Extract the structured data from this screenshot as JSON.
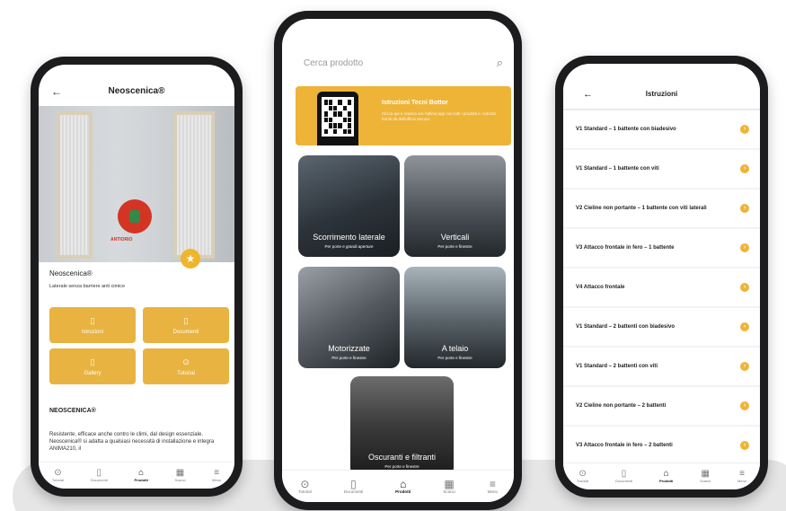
{
  "colors": {
    "accent": "#e8b341",
    "alert": "#d43424"
  },
  "left": {
    "back_icon": "arrow-left-icon",
    "title": "Neoscenica®",
    "red_button_label": "ANTIORIO",
    "product_name": "Neoscenica®",
    "product_desc": "Laterale senza barriere anti cimice",
    "tiles": [
      {
        "label": "Istruzioni",
        "icon": "▯"
      },
      {
        "label": "Documenti",
        "icon": "▯"
      },
      {
        "label": "Gallery",
        "icon": "▯"
      },
      {
        "label": "Tutorial",
        "icon": "⊙"
      }
    ],
    "section_title": "NEOSCENICA®",
    "section_body": "Resistente, efficace anche contro le climi, dal design essenziale. Neoscenica® si adatta a qualsiasi necessità di installazione e integra ANIMA210, il",
    "tabs": [
      {
        "label": "Tutorial",
        "icon": "⊙"
      },
      {
        "label": "Documenti",
        "icon": "▯"
      },
      {
        "label": "Prodotti",
        "icon": "⌂"
      },
      {
        "label": "Scanci",
        "icon": "▦"
      },
      {
        "label": "Menu",
        "icon": "≡"
      }
    ]
  },
  "mid": {
    "search_placeholder": "Cerca prodotto",
    "promo_title": "Istruzioni Tecni Bottor",
    "promo_body": "Clicca qui e scarica ora l'ultima app con tutti i prodotti e i tutorial forniti da dall'ufficio tecnico",
    "categories": [
      {
        "title": "Scorrimento laterale",
        "subtitle": "Per porte e grandi aperture"
      },
      {
        "title": "Verticali",
        "subtitle": "Per porte e finestre"
      },
      {
        "title": "Motorizzate",
        "subtitle": "Per porte e finestre"
      },
      {
        "title": "A telaio",
        "subtitle": "Per porte e finestre"
      },
      {
        "title": "Oscuranti e filtranti",
        "subtitle": "Per porte e finestre"
      }
    ],
    "tabs": [
      {
        "label": "Tutorial",
        "icon": "⊙"
      },
      {
        "label": "Documenti",
        "icon": "▯"
      },
      {
        "label": "Prodotti",
        "icon": "⌂"
      },
      {
        "label": "Scanci",
        "icon": "▦"
      },
      {
        "label": "Menu",
        "icon": "≡"
      }
    ]
  },
  "right": {
    "back_icon": "arrow-left-icon",
    "title": "Istruzioni",
    "items": [
      "V1 Standard – 1 battente con biadesivo",
      "V1 Standard – 1 battente con viti",
      "V2 Cieline non portante – 1 battente con viti laterali",
      "V3 Attacco frontale in fero – 1 battente",
      "V4 Attacco frontale",
      "V1 Standard – 2 battenti con biadesivo",
      "V1 Standard – 2 battenti con viti",
      "V2 Cieline non portante – 2 battenti",
      "V3 Attacco frontale in fero – 2 battenti"
    ],
    "tabs": [
      {
        "label": "Tutorial",
        "icon": "⊙"
      },
      {
        "label": "Documenti",
        "icon": "▯"
      },
      {
        "label": "Prodotti",
        "icon": "⌂"
      },
      {
        "label": "Scanci",
        "icon": "▦"
      },
      {
        "label": "Menu",
        "icon": "≡"
      }
    ]
  }
}
